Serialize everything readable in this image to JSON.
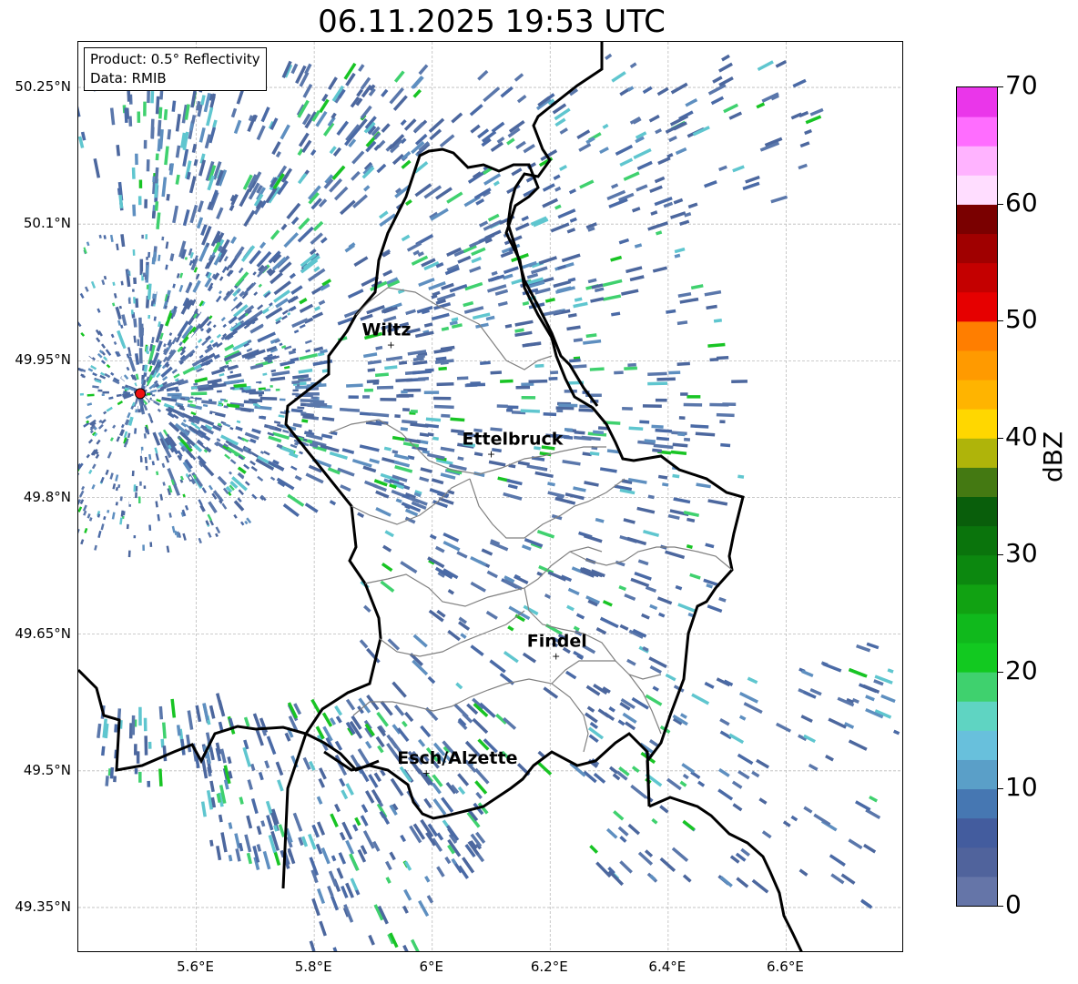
{
  "title": "06.11.2025 19:53 UTC",
  "info": {
    "product": "Product: 0.5° Reflectivity",
    "data": "Data: RMIB"
  },
  "map": {
    "lon_range": [
      5.4,
      6.8
    ],
    "lat_range": [
      49.3,
      50.3
    ],
    "lat_ticks": [
      "50.25°N",
      "50.1°N",
      "49.95°N",
      "49.8°N",
      "49.65°N",
      "49.5°N",
      "49.35°N"
    ],
    "lat_tick_values": [
      50.25,
      50.1,
      49.95,
      49.8,
      49.65,
      49.5,
      49.35
    ],
    "lon_ticks": [
      "5.6°E",
      "5.8°E",
      "6°E",
      "6.2°E",
      "6.4°E",
      "6.6°E"
    ],
    "lon_tick_values": [
      5.6,
      5.8,
      6.0,
      6.2,
      6.4,
      6.6
    ],
    "grid": true,
    "radar_site": {
      "lon": 5.505,
      "lat": 49.914
    },
    "cities": [
      {
        "name": "Wiltz",
        "lon": 5.93,
        "lat": 49.968
      },
      {
        "name": "Ettelbruck",
        "lon": 6.1,
        "lat": 49.848
      },
      {
        "name": "Findel",
        "lon": 6.21,
        "lat": 49.626
      },
      {
        "name": "Esch/Alzette",
        "lon": 5.99,
        "lat": 49.498
      }
    ]
  },
  "colorbar": {
    "label": "dBZ",
    "min": 0,
    "max": 70,
    "tick_labels": [
      "0",
      "10",
      "20",
      "30",
      "40",
      "50",
      "60",
      "70"
    ],
    "colors": [
      "#6575a8",
      "#50639c",
      "#435c9e",
      "#4677b2",
      "#5a9fc8",
      "#68c0dc",
      "#5fd4c2",
      "#3fd16e",
      "#12c920",
      "#10b91c",
      "#11a212",
      "#0c880f",
      "#0a740c",
      "#095e0b",
      "#447912",
      "#afb40a",
      "#ffd700",
      "#ffb400",
      "#ff9a00",
      "#ff7e00",
      "#e60000",
      "#c40000",
      "#a00000",
      "#7a0000",
      "#ffddff",
      "#ffb3ff",
      "#ff6dff",
      "#ea36ea"
    ]
  }
}
